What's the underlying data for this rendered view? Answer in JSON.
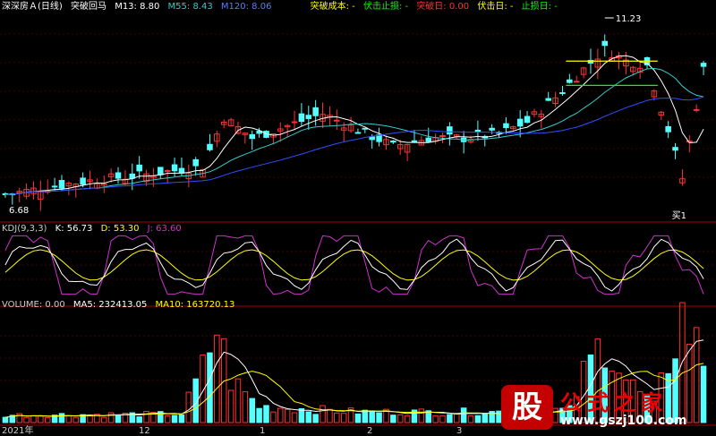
{
  "header": {
    "stock": "深深房Ａ(日线)",
    "indicator": "突破回马",
    "m13": "M13: 8.80",
    "m55": "M55: 8.43",
    "m120": "M120: 8.06",
    "cost": "突破成本: -",
    "fuji_stop": "伏击止损: -",
    "break_day": "突破日: 0.00",
    "fuji_day": "伏击日: -",
    "stop_day": "止损日: -"
  },
  "kdj_header": {
    "name": "KDJ(9,3,3)",
    "k": "K: 56.73",
    "d": "D: 53.30",
    "j": "J: 63.60"
  },
  "vol_header": {
    "name": "VOLUME: 0.00",
    "ma5": "MA5: 232413.05",
    "ma10": "MA10: 163720.13"
  },
  "annotations": {
    "high": "11.23",
    "low": "6.68",
    "buy": "买1",
    "sell": "卖1",
    "buy2": "吸2"
  },
  "xaxis": {
    "labels": [
      "2021年",
      "12",
      "1",
      "2",
      "3"
    ]
  },
  "watermark": {
    "logo": "股",
    "title": "公式之家",
    "url": "www.gszj100.com"
  },
  "colors": {
    "up": "#ff3232",
    "down": "#54ffff",
    "m13": "#ffffff",
    "m55": "#3cc",
    "m120": "#3050ff",
    "k": "#ffffff",
    "d": "#ffff00",
    "j": "#cc33cc",
    "grid": "#8b0000"
  },
  "chart_data": {
    "type": "candlestick",
    "n": 100,
    "price_range": [
      6.4,
      11.4
    ],
    "close_anchors": [
      [
        0,
        6.9
      ],
      [
        10,
        7.2
      ],
      [
        20,
        7.4
      ],
      [
        28,
        7.6
      ],
      [
        31,
        8.8
      ],
      [
        35,
        8.3
      ],
      [
        40,
        8.6
      ],
      [
        45,
        8.9
      ],
      [
        50,
        8.5
      ],
      [
        55,
        8.1
      ],
      [
        60,
        8.3
      ],
      [
        65,
        8.3
      ],
      [
        70,
        8.4
      ],
      [
        74,
        8.7
      ],
      [
        78,
        9.3
      ],
      [
        82,
        10.0
      ],
      [
        85,
        10.5
      ],
      [
        88,
        10.2
      ],
      [
        91,
        10.1
      ],
      [
        94,
        8.5
      ],
      [
        96,
        7.3
      ],
      [
        99,
        10.0
      ]
    ],
    "volume_max": 1.0,
    "volume_anchors": [
      [
        0,
        0.07
      ],
      [
        25,
        0.08
      ],
      [
        28,
        0.5
      ],
      [
        30,
        0.9
      ],
      [
        32,
        0.4
      ],
      [
        36,
        0.15
      ],
      [
        50,
        0.1
      ],
      [
        70,
        0.1
      ],
      [
        80,
        0.12
      ],
      [
        82,
        0.45
      ],
      [
        85,
        0.8
      ],
      [
        88,
        0.4
      ],
      [
        92,
        0.15
      ],
      [
        96,
        1.0
      ],
      [
        99,
        0.6
      ]
    ],
    "kdj_range": [
      0,
      100
    ]
  }
}
